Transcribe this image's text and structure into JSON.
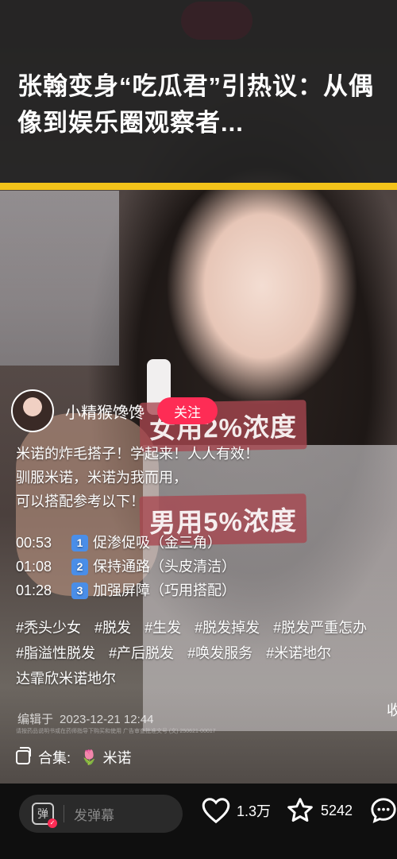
{
  "banner": {
    "title": "张翰变身“吃瓜君”引热议：从偶像到娱乐圈观察者..."
  },
  "video": {
    "overlay_text_1": "女用2%浓度",
    "overlay_text_2": "男用5%浓度"
  },
  "author": {
    "name": "小精猴馋馋",
    "follow_label": "关注"
  },
  "caption": {
    "lines": [
      "米诺的炸毛搭子！学起来！人人有效！",
      "驯服米诺，米诺为我而用，",
      "可以搭配参考以下！"
    ]
  },
  "chapters": [
    {
      "time": "00:53",
      "num": "1",
      "label": "促渗促吸（金三角）"
    },
    {
      "time": "01:08",
      "num": "2",
      "label": "保持通路（头皮清洁）"
    },
    {
      "time": "01:28",
      "num": "3",
      "label": "加强屏障（巧用搭配）"
    }
  ],
  "tags": [
    "#秃头少女",
    "#脱发",
    "#生发",
    "#脱发掉发",
    "#脱发严重怎办",
    "#脂溢性脱发",
    "#产后脱发",
    "#唤发服务",
    "#米诺地尔",
    "达霏欣米诺地尔"
  ],
  "edit": {
    "prefix": "编辑于",
    "datetime": "2023-12-21 12:44",
    "side_char": "收"
  },
  "fine_print": "请按药品说明书或在药师指导下购买和使用 广告审查批准文号 (文) 250621-00017",
  "collection": {
    "label": "合集:",
    "name": "米诺"
  },
  "bottom": {
    "danmaku_toggle": "弹",
    "danmaku_placeholder": "发弹幕",
    "likes": "1.3万",
    "favorites": "5242"
  }
}
